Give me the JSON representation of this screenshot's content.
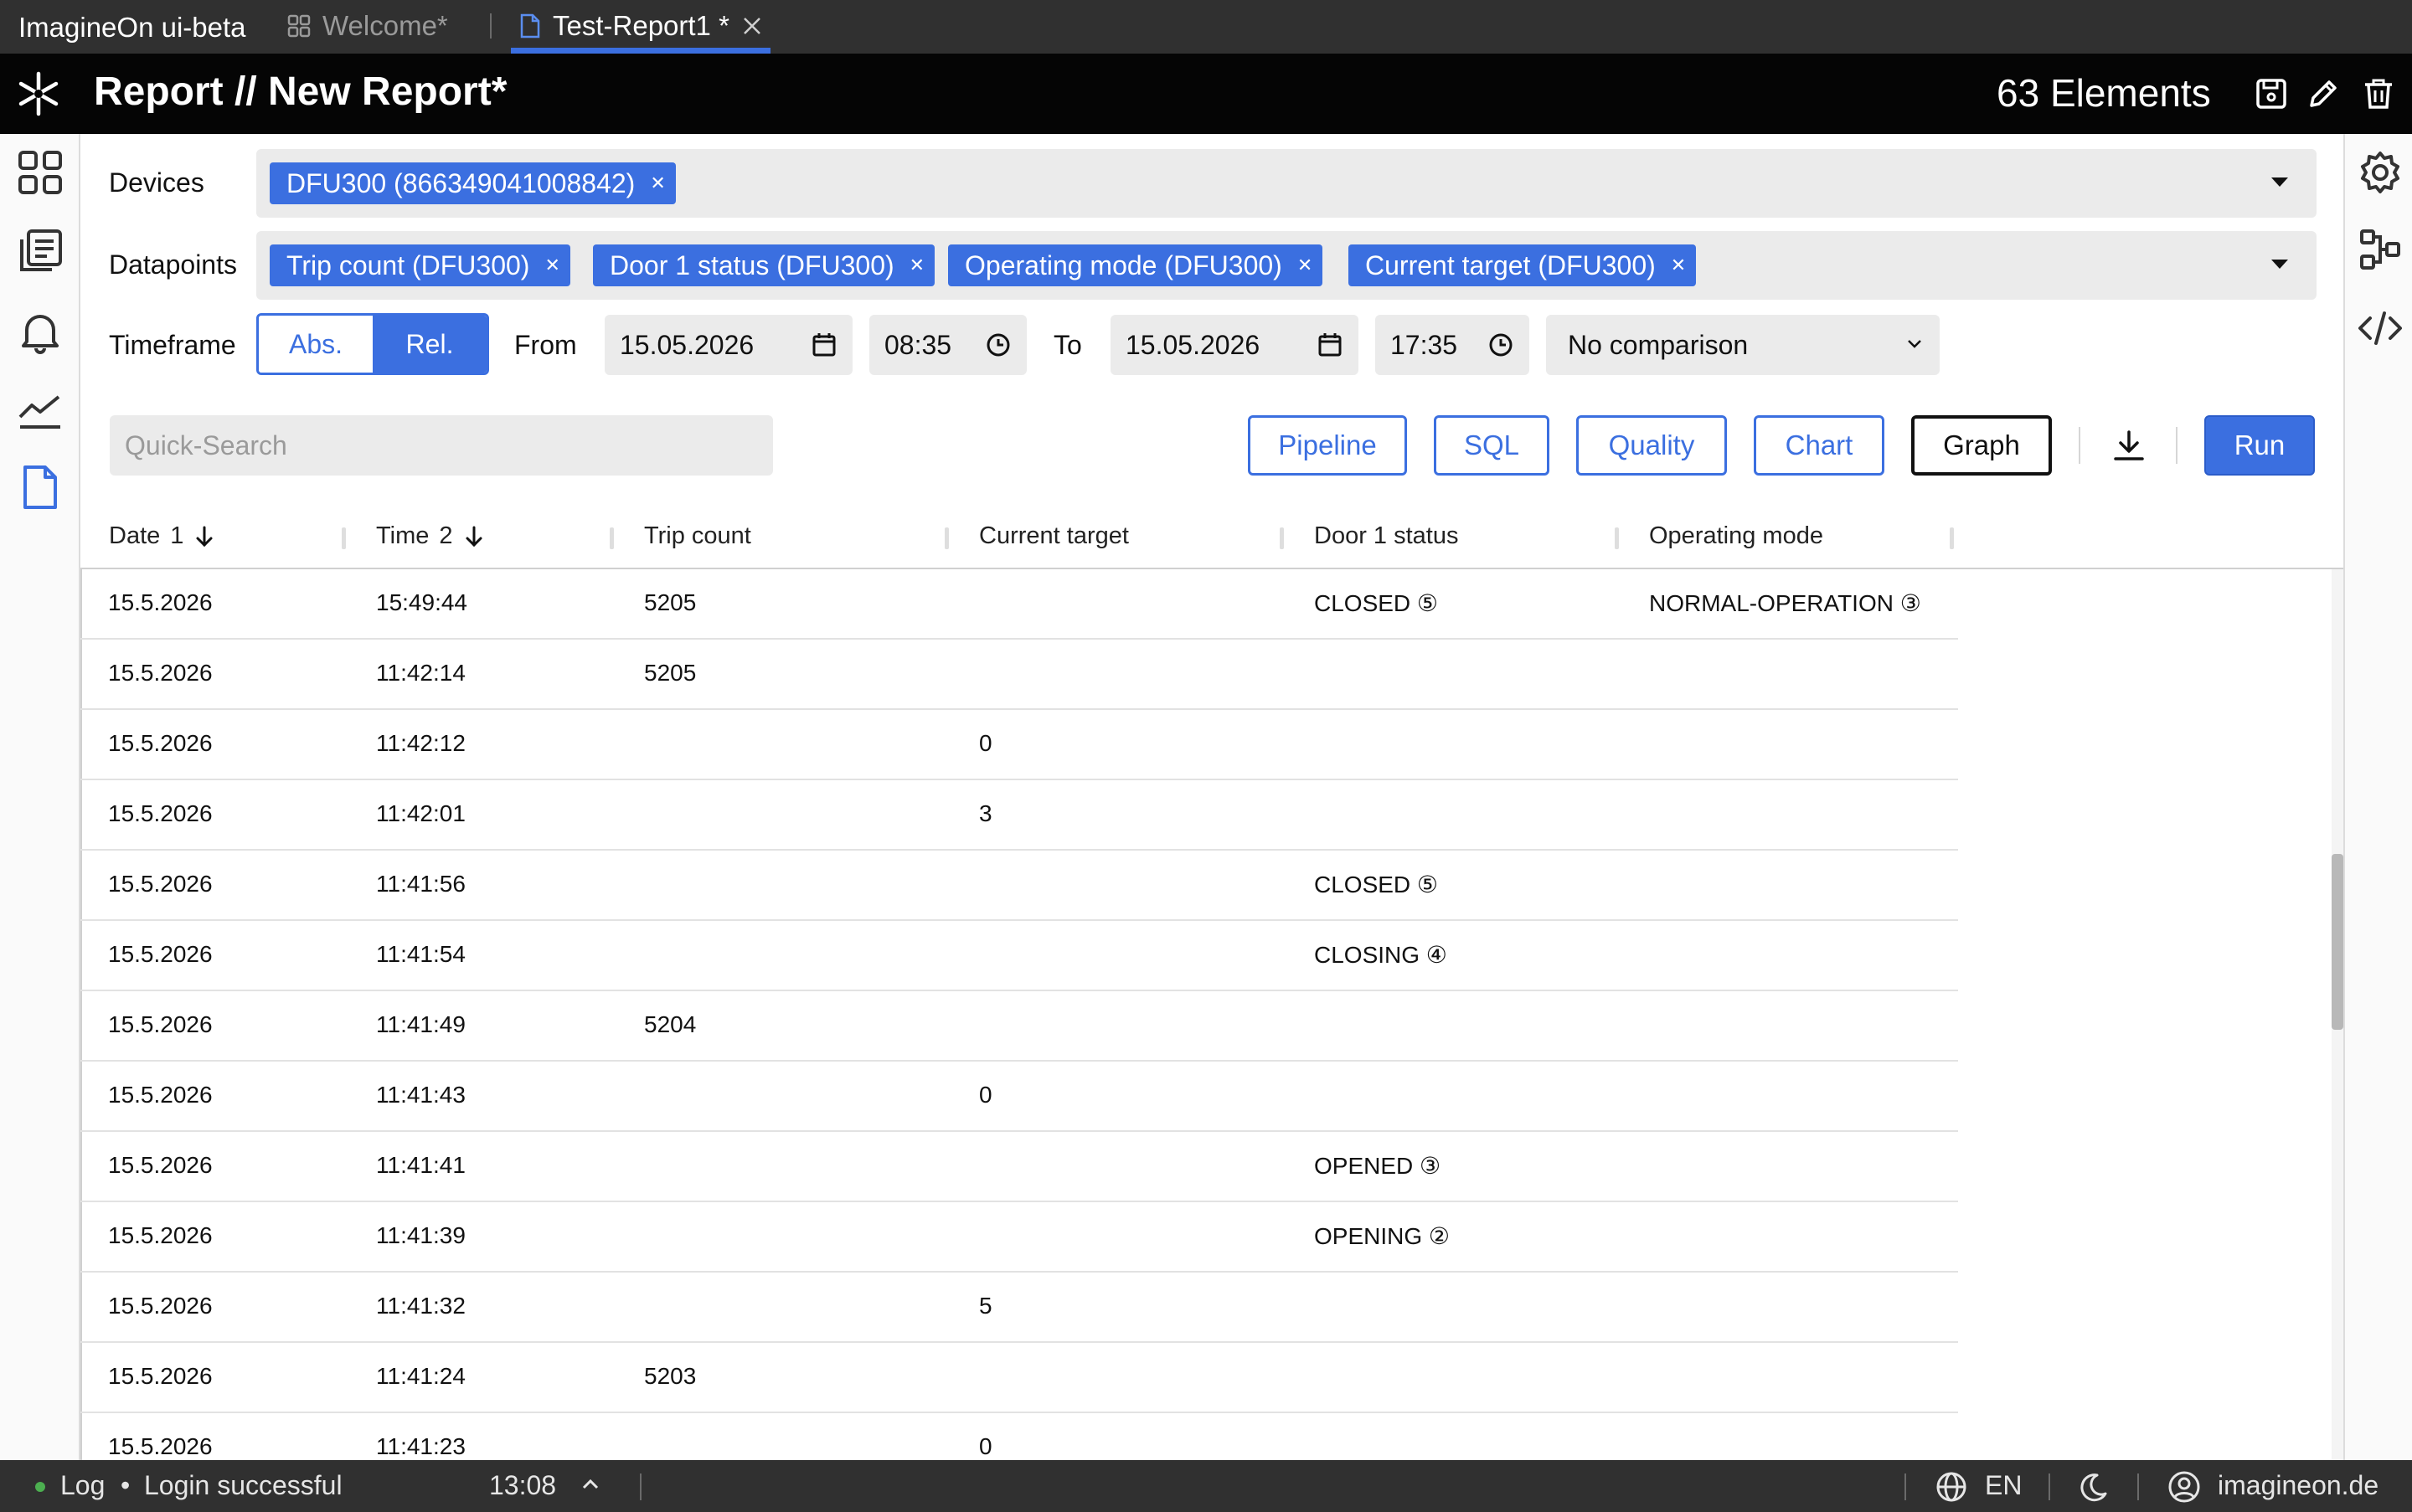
{
  "tabbar": {
    "app_name": "ImagineOn  ui-beta",
    "tabs": [
      {
        "label": "Welcome*",
        "icon": "grid-icon",
        "active": false
      },
      {
        "label": "Test-Report1 *",
        "icon": "file-icon",
        "active": true
      }
    ]
  },
  "header": {
    "title": "Report // New Report*",
    "count": "63 Elements",
    "icons": [
      "save-icon",
      "edit-icon",
      "trash-icon"
    ]
  },
  "left_nav": [
    "dashboard-icon",
    "reports-list-icon",
    "bell-icon",
    "chart-line-icon",
    "document-icon"
  ],
  "right_nav": [
    "gear-icon",
    "pipeline-icon",
    "code-icon"
  ],
  "filters": {
    "devices_label": "Devices",
    "devices": [
      "DFU300 (866349041008842)"
    ],
    "datapoints_label": "Datapoints",
    "datapoints": [
      "Trip count (DFU300)",
      "Door 1 status (DFU300)",
      "Operating mode (DFU300)",
      "Current target (DFU300)"
    ],
    "timeframe_label": "Timeframe",
    "timeframe_options": [
      "Abs.",
      "Rel."
    ],
    "timeframe_selected": "Rel.",
    "from_label": "From",
    "from_date": "15.05.2026",
    "from_time": "08:35",
    "to_label": "To",
    "to_date": "15.05.2026",
    "to_time": "17:35",
    "comparison": "No comparison"
  },
  "toolbar": {
    "search_placeholder": "Quick-Search",
    "buttons": [
      "Pipeline",
      "SQL",
      "Quality",
      "Chart",
      "Graph"
    ],
    "active_button": "Graph",
    "run_label": "Run"
  },
  "table": {
    "columns": [
      {
        "label": "Date",
        "sort_index": "1"
      },
      {
        "label": "Time",
        "sort_index": "2"
      },
      {
        "label": "Trip count",
        "sort_index": ""
      },
      {
        "label": "Current target",
        "sort_index": ""
      },
      {
        "label": "Door 1 status",
        "sort_index": ""
      },
      {
        "label": "Operating mode",
        "sort_index": ""
      }
    ],
    "rows": [
      [
        "15.5.2026",
        "15:49:44",
        "5205",
        "",
        "CLOSED ⑤",
        "NORMAL-OPERATION ③"
      ],
      [
        "15.5.2026",
        "11:42:14",
        "5205",
        "",
        "",
        ""
      ],
      [
        "15.5.2026",
        "11:42:12",
        "",
        "0",
        "",
        ""
      ],
      [
        "15.5.2026",
        "11:42:01",
        "",
        "3",
        "",
        ""
      ],
      [
        "15.5.2026",
        "11:41:56",
        "",
        "",
        "CLOSED ⑤",
        ""
      ],
      [
        "15.5.2026",
        "11:41:54",
        "",
        "",
        "CLOSING ④",
        ""
      ],
      [
        "15.5.2026",
        "11:41:49",
        "5204",
        "",
        "",
        ""
      ],
      [
        "15.5.2026",
        "11:41:43",
        "",
        "0",
        "",
        ""
      ],
      [
        "15.5.2026",
        "11:41:41",
        "",
        "",
        "OPENED ③",
        ""
      ],
      [
        "15.5.2026",
        "11:41:39",
        "",
        "",
        "OPENING ②",
        ""
      ],
      [
        "15.5.2026",
        "11:41:32",
        "",
        "5",
        "",
        ""
      ],
      [
        "15.5.2026",
        "11:41:24",
        "5203",
        "",
        "",
        ""
      ],
      [
        "15.5.2026",
        "11:41:23",
        "",
        "0",
        "",
        ""
      ]
    ]
  },
  "statusbar": {
    "log_label": "Log",
    "message": "Login successful",
    "time": "13:08",
    "language": "EN",
    "account": "imagineon.de"
  }
}
